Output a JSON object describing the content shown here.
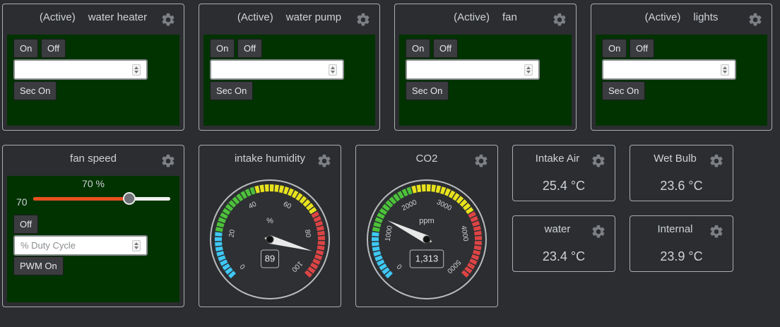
{
  "switches": [
    {
      "status": "(Active)",
      "name": "water heater",
      "on_label": "On",
      "off_label": "Off",
      "seconds_value": "",
      "sec_on_label": "Sec On"
    },
    {
      "status": "(Active)",
      "name": "water pump",
      "on_label": "On",
      "off_label": "Off",
      "seconds_value": "",
      "sec_on_label": "Sec On"
    },
    {
      "status": "(Active)",
      "name": "fan",
      "on_label": "On",
      "off_label": "Off",
      "seconds_value": "",
      "sec_on_label": "Sec On"
    },
    {
      "status": "(Active)",
      "name": "lights",
      "on_label": "On",
      "off_label": "Off",
      "seconds_value": "",
      "sec_on_label": "Sec On"
    }
  ],
  "fan_speed": {
    "title": "fan speed",
    "percent_readout": "70 %",
    "slider_value_label": "70",
    "slider_value": 70,
    "slider_min": 0,
    "slider_max": 100,
    "off_label": "Off",
    "duty_placeholder": "% Duty Cycle",
    "pwm_on_label": "PWM On"
  },
  "gauges": [
    {
      "title": "intake humidity",
      "unit": "%",
      "value": 89,
      "value_label": "89",
      "min": 0,
      "max": 100,
      "tick_labels": [
        "0",
        "20",
        "40",
        "60",
        "80",
        "100"
      ]
    },
    {
      "title": "CO2",
      "unit": "ppm",
      "value": 1313,
      "value_label": "1,313",
      "min": 0,
      "max": 5000,
      "tick_labels": [
        "0",
        "1000",
        "2000",
        "3000",
        "4000",
        "5000"
      ]
    }
  ],
  "sensors": [
    {
      "name": "Intake Air",
      "value": "25.4 °C"
    },
    {
      "name": "Wet Bulb",
      "value": "23.6 °C"
    },
    {
      "name": "water",
      "value": "23.4 °C"
    },
    {
      "name": "Internal",
      "value": "23.9 °C"
    }
  ],
  "icons": {
    "settings": "gear-icon"
  },
  "colors": {
    "panel_bg": "#013301",
    "slider_fill": "#e8501e",
    "gauge_blue": "#3ec8f5",
    "gauge_green": "#4cc23a",
    "gauge_yellow": "#e8e21c",
    "gauge_red": "#de4444"
  }
}
